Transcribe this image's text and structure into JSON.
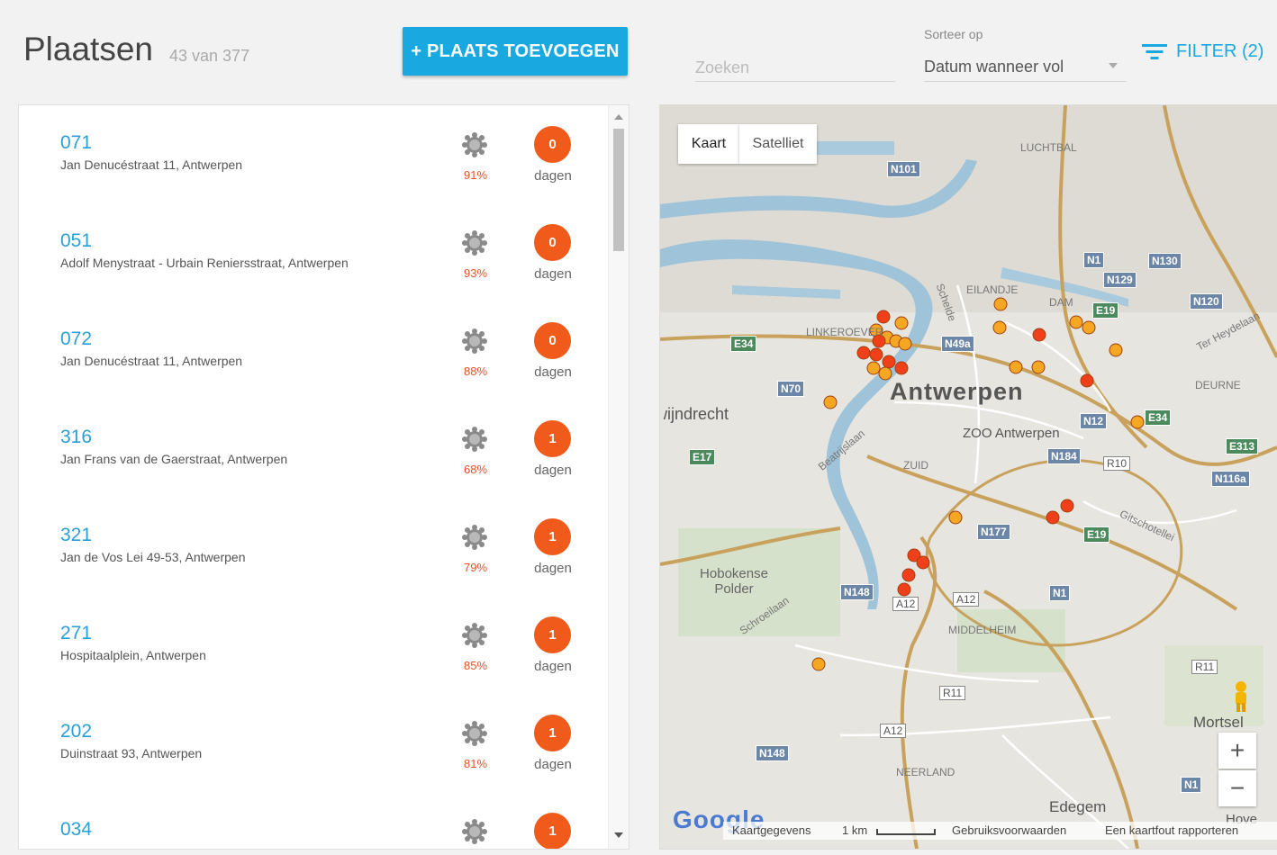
{
  "header": {
    "title": "Plaatsen",
    "count": "43 van 377",
    "add_button": "+ PLAATS TOEVOEGEN",
    "search_placeholder": "Zoeken",
    "sort_label": "Sorteer op",
    "sort_value": "Datum wanneer vol",
    "filter_button": "FILTER (2)"
  },
  "colors": {
    "accent": "#19a8e0",
    "badge": "#f05a1a",
    "percent": "#e8502a"
  },
  "places": [
    {
      "code": "071",
      "address": "Jan Denucéstraat 11, Antwerpen",
      "percent": "91%",
      "days": "0",
      "days_label": "dagen"
    },
    {
      "code": "051",
      "address": "Adolf Menystraat - Urbain Reniersstraat, Antwerpen",
      "percent": "93%",
      "days": "0",
      "days_label": "dagen"
    },
    {
      "code": "072",
      "address": "Jan Denucéstraat 11, Antwerpen",
      "percent": "88%",
      "days": "0",
      "days_label": "dagen"
    },
    {
      "code": "316",
      "address": "Jan Frans van de Gaerstraat, Antwerpen",
      "percent": "68%",
      "days": "1",
      "days_label": "dagen"
    },
    {
      "code": "321",
      "address": "Jan de Vos Lei 49-53, Antwerpen",
      "percent": "79%",
      "days": "1",
      "days_label": "dagen"
    },
    {
      "code": "271",
      "address": "Hospitaalplein, Antwerpen",
      "percent": "85%",
      "days": "1",
      "days_label": "dagen"
    },
    {
      "code": "202",
      "address": "Duinstraat 93, Antwerpen",
      "percent": "81%",
      "days": "1",
      "days_label": "dagen"
    },
    {
      "code": "034",
      "address": "",
      "percent": "",
      "days": "1",
      "days_label": ""
    }
  ],
  "map": {
    "type_map": "Kaart",
    "type_satellite": "Satelliet",
    "city": "Antwerpen",
    "zoo": "ZOO Antwerpen",
    "districts": [
      "LUCHTBAL",
      "EILANDJE",
      "DAM",
      "LINKEROEVER",
      "DEURNE",
      "ZUID",
      "MIDDELHEIM",
      "NEERLAND"
    ],
    "places": [
      "Zwijndrecht",
      "Hobokense Polder",
      "Mortsel",
      "Edegem",
      "Hove"
    ],
    "streets": [
      "Schelde",
      "Beatrijslaan",
      "Schroeilaan",
      "Ter Heydelaan",
      "Gitschotellei"
    ],
    "roads": [
      "N101",
      "N1",
      "N130",
      "N129",
      "N120",
      "E19",
      "E34",
      "N49a",
      "N70",
      "N12",
      "E313",
      "E17",
      "N184",
      "R10",
      "N116a",
      "N177",
      "E19",
      "N148",
      "A12",
      "A12",
      "N1",
      "R11",
      "R11",
      "A12",
      "N148",
      "N1",
      "E34"
    ],
    "logo": "Google",
    "attribution": "Kaartgegevens",
    "scale": "1 km",
    "terms": "Gebruiksvoorwaarden",
    "report": "Een kaartfout rapporteren",
    "zoom_in": "+",
    "zoom_out": "−"
  }
}
